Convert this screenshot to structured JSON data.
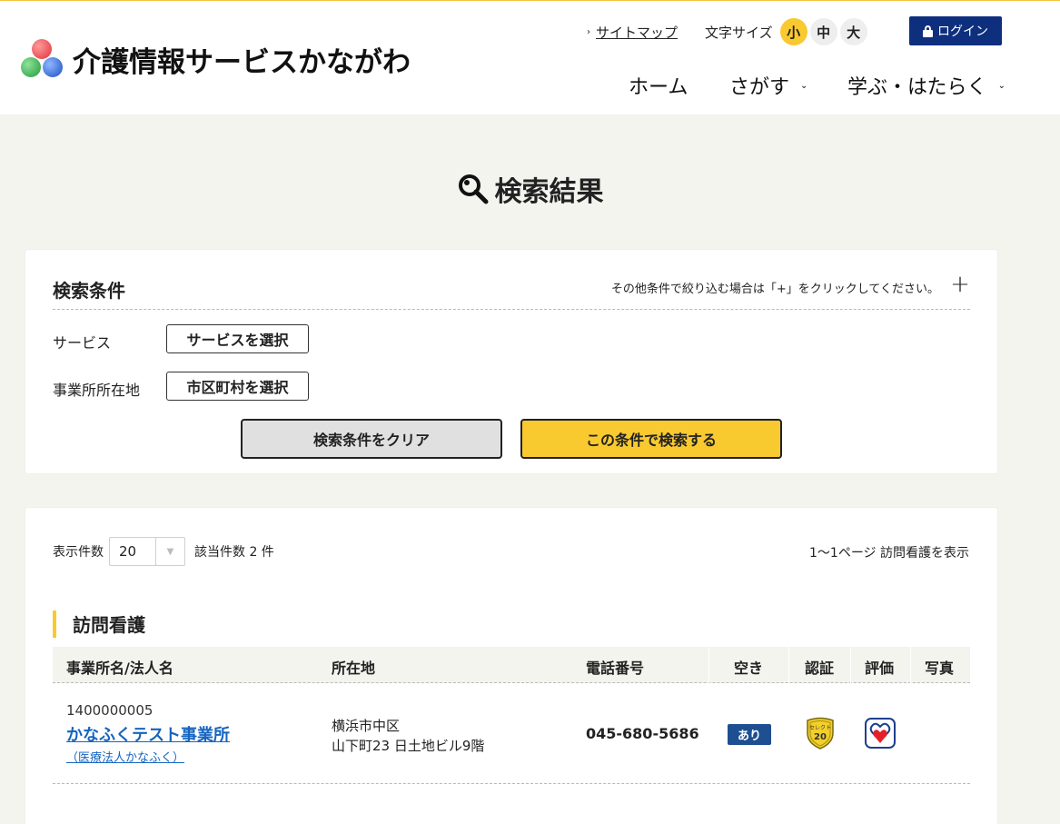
{
  "header": {
    "site_title": "介護情報サービスかながわ",
    "sitemap_label": "サイトマップ",
    "font_size_label": "文字サイズ",
    "font_sizes": [
      "小",
      "中",
      "大"
    ],
    "font_size_active": "小",
    "login_label": "ログイン",
    "nav": [
      {
        "label": "ホーム"
      },
      {
        "label": "さがす"
      },
      {
        "label": "学ぶ・はたらく"
      }
    ]
  },
  "page": {
    "title": "検索結果"
  },
  "search_conditions": {
    "title": "検索条件",
    "note": "その他条件で絞り込む場合は「+」をクリックしてください。",
    "service_label": "サービス",
    "service_button": "サービスを選択",
    "location_label": "事業所所在地",
    "location_button": "市区町村を選択",
    "clear_button": "検索条件をクリア",
    "search_button": "この条件で検索する"
  },
  "results": {
    "display_count_label": "表示件数",
    "display_count_value": "20",
    "hit_count_text": "該当件数 2 件",
    "page_info": "1〜1ページ 訪問看護を表示",
    "section_title": "訪問看護",
    "columns": [
      "事業所名/法人名",
      "所在地",
      "電話番号",
      "空き",
      "認証",
      "評価",
      "写真"
    ],
    "rows": [
      {
        "office_no": "1400000005",
        "office_name": "かなふくテスト事業所",
        "corp_name": "（医療法人かなふく）",
        "address_line1": "横浜市中区",
        "address_line2": "山下町23 日土地ビル9階",
        "tel": "045-680-5686",
        "availability": "あり",
        "cert_badge_text": "セレクト",
        "cert_badge_num": "20"
      }
    ]
  },
  "colors": {
    "accent": "#f9c930",
    "navy": "#0d2f7e",
    "link": "#1565c0",
    "badge": "#1d4f91"
  }
}
